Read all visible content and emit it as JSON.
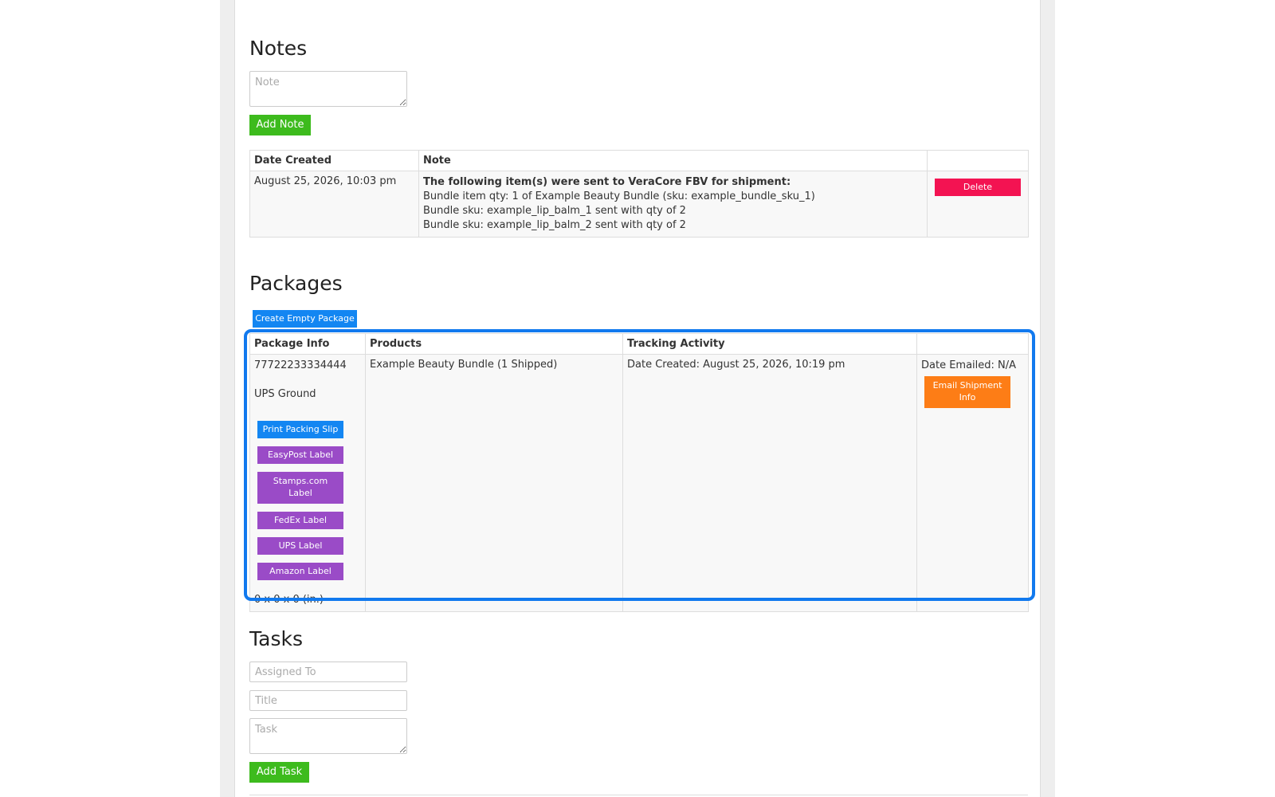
{
  "notes": {
    "heading": "Notes",
    "note_placeholder": "Note",
    "add_button": "Add Note",
    "table": {
      "headers": [
        "Date Created",
        "Note",
        ""
      ],
      "rows": [
        {
          "date": "August 25, 2026, 10:03 pm",
          "note_heading": "The following item(s) were sent to VeraCore FBV for shipment:",
          "note_lines": [
            "Bundle item qty: 1 of Example Beauty Bundle (sku: example_bundle_sku_1)",
            "Bundle sku: example_lip_balm_1 sent with qty of 2",
            "Bundle sku: example_lip_balm_2 sent with qty of 2"
          ],
          "delete_label": "Delete"
        }
      ]
    }
  },
  "packages": {
    "heading": "Packages",
    "create_button": "Create Empty Package",
    "table": {
      "headers": [
        "Package Info",
        "Products",
        "Tracking Activity",
        ""
      ],
      "row": {
        "tracking_number": "77722233334444",
        "service": "UPS Ground",
        "buttons": {
          "packing_slip": "Print Packing Slip",
          "easypost": "EasyPost Label",
          "stamps": "Stamps.com Label",
          "fedex": "FedEx Label",
          "ups": "UPS Label",
          "amazon": "Amazon Label"
        },
        "dimensions": "0 x 0 x 0 (in.)",
        "products": "Example Beauty Bundle (1 Shipped)",
        "tracking": "Date Created: August 25, 2026, 10:19 pm",
        "date_emailed": "Date Emailed: N/A",
        "email_button": "Email Shipment Info"
      }
    }
  },
  "tasks": {
    "heading": "Tasks",
    "assigned_placeholder": "Assigned To",
    "title_placeholder": "Title",
    "task_placeholder": "Task",
    "add_button": "Add Task"
  },
  "colors": {
    "green": "#3dbb1d",
    "blue": "#1386f2",
    "purple": "#9a4bc7",
    "red": "#f31352",
    "orange": "#fd7d16",
    "highlight": "#1179ee"
  }
}
